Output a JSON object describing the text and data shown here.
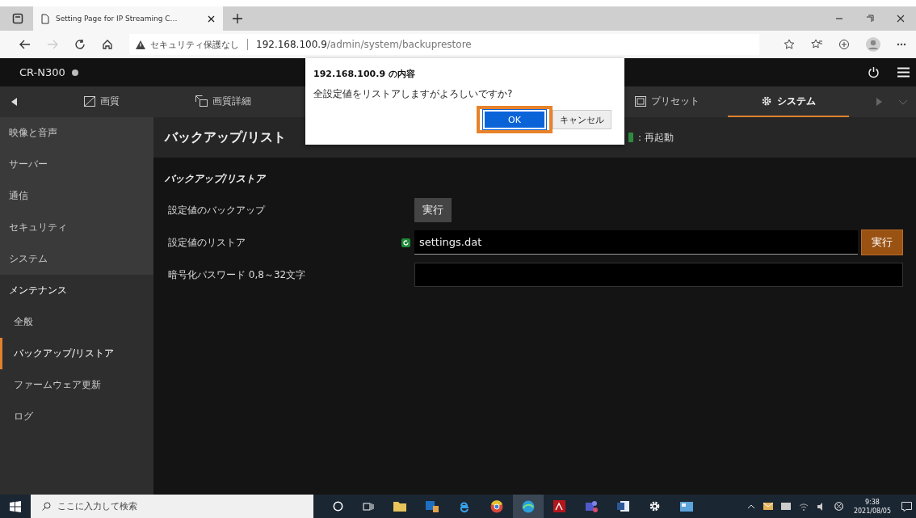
{
  "browser": {
    "tab_title": "Setting Page for IP Streaming C…",
    "security": "セキュリティ保護なし",
    "url_host": "192.168.100.9",
    "url_path": "/admin/system/backuprestore"
  },
  "app": {
    "device": "CR-N300",
    "nav_tabs": [
      {
        "label": "画質",
        "selected": false
      },
      {
        "label": "画質詳細",
        "selected": false
      },
      {
        "label": "プリセット",
        "selected": false
      },
      {
        "label": "システム",
        "selected": true
      }
    ],
    "sidebar": [
      {
        "label": "映像と音声",
        "selected": false
      },
      {
        "label": "サーバー",
        "selected": false
      },
      {
        "label": "通信",
        "selected": false
      },
      {
        "label": "セキュリティ",
        "selected": false
      },
      {
        "label": "システム",
        "selected": false
      },
      {
        "label": "メンテナンス",
        "selected": false,
        "children": [
          {
            "label": "全般",
            "selected": false
          },
          {
            "label": "バックアップ/リストア",
            "selected": true
          },
          {
            "label": "ファームウェア更新",
            "selected": false
          },
          {
            "label": "ログ",
            "selected": false
          }
        ]
      }
    ],
    "page_title": "バックアップ/リスト",
    "reboot_label": "：再起動",
    "section_title": "バックアップ/リストア",
    "rows": [
      {
        "kind": "button",
        "label": "設定値のバックアップ",
        "button": "実行"
      },
      {
        "kind": "file",
        "label": "設定値のリストア",
        "value": "settings.dat",
        "button": "実行"
      },
      {
        "kind": "password",
        "label": "暗号化パスワード 0,8～32文字"
      }
    ]
  },
  "dialog": {
    "title": "192.168.100.9 の内容",
    "message": "全設定値をリストアしますがよろしいですか?",
    "buttons": [
      {
        "label": "OK",
        "selected": true
      },
      {
        "label": "キャンセル",
        "selected": false
      }
    ]
  },
  "taskbar": {
    "search_placeholder": "ここに入力して検索",
    "time": "9:38",
    "date": "2021/08/05"
  }
}
